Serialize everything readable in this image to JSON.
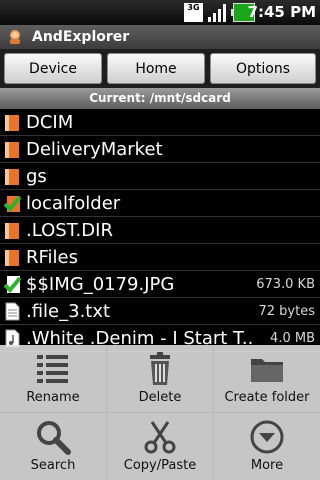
{
  "status_bar": {
    "network": "3G",
    "time": "7:45 PM"
  },
  "app": {
    "title": "AndExplorer"
  },
  "toolbar": {
    "device": "Device",
    "home": "Home",
    "options": "Options"
  },
  "current_path": "Current: /mnt/sdcard",
  "files": [
    {
      "name": "DCIM",
      "size": "",
      "icon": "folder-icon"
    },
    {
      "name": "DeliveryMarket",
      "size": "",
      "icon": "folder-icon"
    },
    {
      "name": "gs",
      "size": "",
      "icon": "folder-icon"
    },
    {
      "name": "localfolder",
      "size": "",
      "icon": "checked-folder-icon"
    },
    {
      "name": ".LOST.DIR",
      "size": "",
      "icon": "folder-icon"
    },
    {
      "name": "RFiles",
      "size": "",
      "icon": "folder-icon"
    },
    {
      "name": "$$IMG_0179.JPG",
      "size": "673.0 KB",
      "icon": "checked-file-icon"
    },
    {
      "name": ".file_3.txt",
      "size": "72 bytes",
      "icon": "text-file-icon"
    },
    {
      "name": ".White .Denim - I Start T...",
      "size": "4.0 MB",
      "icon": "audio-file-icon"
    }
  ],
  "menu": {
    "rename": "Rename",
    "delete": "Delete",
    "create_folder": "Create folder",
    "search": "Search",
    "copy_paste": "Copy/Paste",
    "more": "More"
  },
  "colors": {
    "folder": "#e8742a",
    "check": "#2fb12f",
    "menu_bg": "#e1e1e1"
  }
}
